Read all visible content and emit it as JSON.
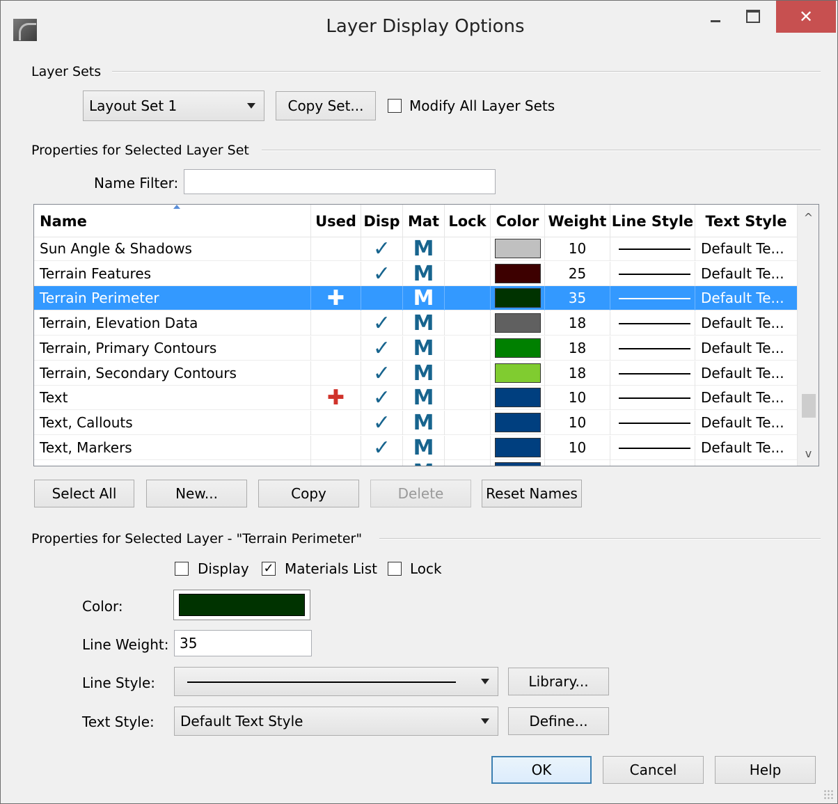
{
  "window": {
    "title": "Layer Display Options",
    "controls": {
      "minimize": "–",
      "maximize": "□",
      "close": "✕"
    }
  },
  "layer_sets": {
    "group_label": "Layer Sets",
    "selected_set": "Layout Set 1",
    "copy_set_label": "Copy Set...",
    "modify_all_label": "Modify All Layer Sets",
    "modify_all_checked": false
  },
  "set_properties": {
    "group_label": "Properties for Selected Layer Set",
    "name_filter_label": "Name Filter:",
    "name_filter_value": ""
  },
  "table": {
    "columns": [
      "Name",
      "Used",
      "Disp",
      "Mat",
      "Lock",
      "Color",
      "Weight",
      "Line Style",
      "Text Style"
    ],
    "rows": [
      {
        "name": "Sun Angle & Shadows",
        "used": "",
        "disp": "✓",
        "mat": "M",
        "lock": "",
        "color": "#c0c0c0",
        "weight": "10",
        "text_style": "Default Te..."
      },
      {
        "name": "Terrain Features",
        "used": "",
        "disp": "✓",
        "mat": "M",
        "lock": "",
        "color": "#3d0000",
        "weight": "25",
        "text_style": "Default Te..."
      },
      {
        "name": "Terrain Perimeter",
        "used": "✚",
        "disp": "",
        "mat": "M",
        "lock": "",
        "color": "#003300",
        "weight": "35",
        "text_style": "Default Te...",
        "selected": true
      },
      {
        "name": "Terrain, Elevation Data",
        "used": "",
        "disp": "✓",
        "mat": "M",
        "lock": "",
        "color": "#606060",
        "weight": "18",
        "text_style": "Default Te..."
      },
      {
        "name": "Terrain, Primary Contours",
        "used": "",
        "disp": "✓",
        "mat": "M",
        "lock": "",
        "color": "#008000",
        "weight": "18",
        "text_style": "Default Te..."
      },
      {
        "name": "Terrain, Secondary Contours",
        "used": "",
        "disp": "✓",
        "mat": "M",
        "lock": "",
        "color": "#80cc30",
        "weight": "18",
        "text_style": "Default Te..."
      },
      {
        "name": "Text",
        "used": "✚",
        "disp": "✓",
        "mat": "M",
        "lock": "",
        "color": "#003f7f",
        "weight": "10",
        "text_style": "Default Te..."
      },
      {
        "name": "Text,  Callouts",
        "used": "",
        "disp": "✓",
        "mat": "M",
        "lock": "",
        "color": "#003f7f",
        "weight": "10",
        "text_style": "Default Te..."
      },
      {
        "name": "Text,  Markers",
        "used": "",
        "disp": "✓",
        "mat": "M",
        "lock": "",
        "color": "#003f7f",
        "weight": "10",
        "text_style": "Default Te..."
      },
      {
        "name": "",
        "used": "",
        "disp": "",
        "mat": "M",
        "lock": "",
        "color": "#003f7f",
        "weight": "",
        "text_style": ""
      }
    ],
    "scroll_up": "^",
    "scroll_down": "v"
  },
  "table_buttons": {
    "select_all": "Select All",
    "new": "New...",
    "copy": "Copy",
    "delete": "Delete",
    "reset_names": "Reset Names"
  },
  "layer_properties": {
    "group_label": "Properties for Selected Layer - \"Terrain Perimeter\"",
    "display_label": "Display",
    "display_checked": false,
    "materials_label": "Materials List",
    "materials_checked": true,
    "lock_label": "Lock",
    "lock_checked": false,
    "color_label": "Color:",
    "color_value": "#003300",
    "line_weight_label": "Line Weight:",
    "line_weight_value": "35",
    "line_style_label": "Line Style:",
    "library_label": "Library...",
    "text_style_label": "Text Style:",
    "text_style_value": "Default Text Style",
    "define_label": "Define..."
  },
  "footer": {
    "ok": "OK",
    "cancel": "Cancel",
    "help": "Help"
  }
}
